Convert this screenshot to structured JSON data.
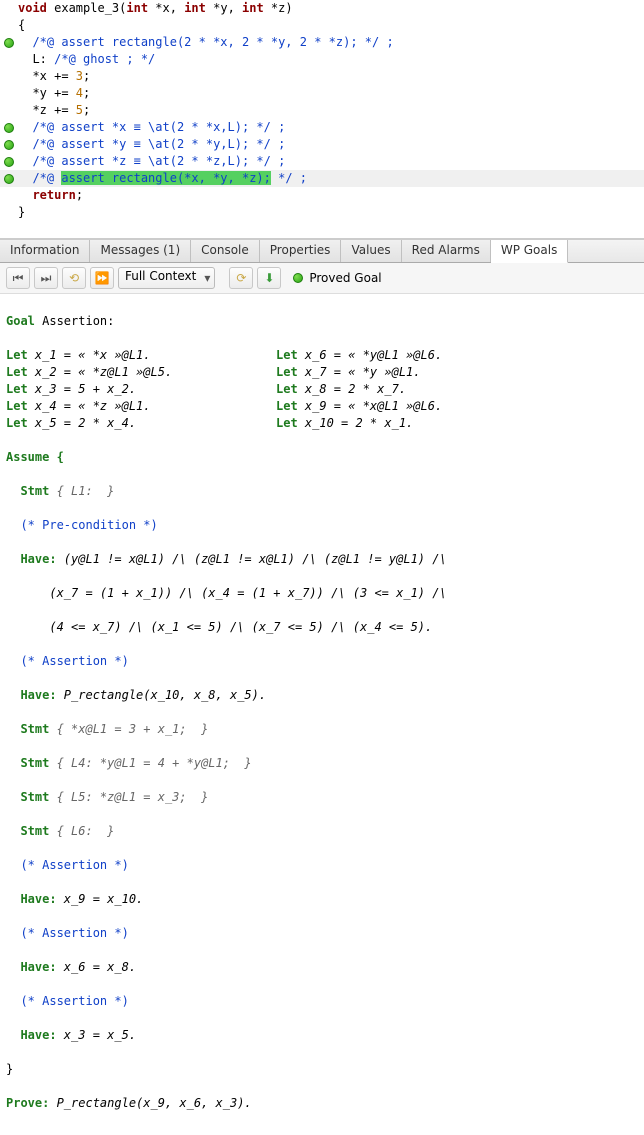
{
  "code": {
    "sig_void": "void",
    "sig_fn": " example_3(",
    "sig_int": "int",
    "sig_p1": " *x, ",
    "sig_p2": " *y, ",
    "sig_p3": " *z)",
    "brace_open": "{",
    "l1": "  /*@ assert rectangle(2 * *x, 2 * *y, 2 * *z); */ ;",
    "l2_a": "  L: ",
    "l2_b": "/*@ ghost ; */",
    "l3_a": "  *x += ",
    "l3_n": "3",
    "l3_b": ";",
    "l4_a": "  *y += ",
    "l4_n": "4",
    "l4_b": ";",
    "l5_a": "  *z += ",
    "l5_n": "5",
    "l5_b": ";",
    "l6": "  /*@ assert *x ≡ \\at(2 * *x,L); */ ;",
    "l7": "  /*@ assert *y ≡ \\at(2 * *y,L); */ ;",
    "l8": "  /*@ assert *z ≡ \\at(2 * *z,L); */ ;",
    "l9_pre": "  /*@ ",
    "l9_sel": "assert rectangle(*x, *y, *z);",
    "l9_post": " */ ;",
    "l10_a": "  ",
    "l10_kw": "return",
    "l10_b": ";",
    "brace_close": "}"
  },
  "tabs": {
    "t0": "Information",
    "t1": "Messages (1)",
    "t2": "Console",
    "t3": "Properties",
    "t4": "Values",
    "t5": "Red Alarms",
    "t6": "WP Goals"
  },
  "toolbar": {
    "context": "Full Context",
    "proved": "Proved Goal"
  },
  "goal": {
    "title_a": "Goal",
    "title_b": " Assertion:",
    "lets": [
      [
        "Let",
        " x_1 = « *x »@L1.",
        "Let",
        " x_6 = « *y@L1 »@L6."
      ],
      [
        "Let",
        " x_2 = « *z@L1 »@L5.",
        "Let",
        " x_7 = « *y »@L1."
      ],
      [
        "Let",
        " x_3 = 5 + x_2.",
        "Let",
        " x_8 = 2 * x_7."
      ],
      [
        "Let",
        " x_4 = « *z »@L1.",
        "Let",
        " x_9 = « *x@L1 »@L6."
      ],
      [
        "Let",
        " x_5 = 2 * x_4.",
        "Let",
        " x_10 = 2 * x_1."
      ]
    ],
    "assume": "Assume {",
    "stmt1_a": "Stmt",
    "stmt1_b": " { L1:  }",
    "c_pre": "(* Pre-condition *)",
    "have1_a": "Have:",
    "have1_b": " (y@L1 != x@L1) /\\ (z@L1 != x@L1) /\\ (z@L1 != y@L1) /\\",
    "have1_c": "      (x_7 = (1 + x_1)) /\\ (x_4 = (1 + x_7)) /\\ (3 <= x_1) /\\",
    "have1_d": "      (4 <= x_7) /\\ (x_1 <= 5) /\\ (x_7 <= 5) /\\ (x_4 <= 5).",
    "c_a1": "(* Assertion *)",
    "have2_a": "Have:",
    "have2_b": " P_rectangle(x_10, x_8, x_5).",
    "stmt2_a": "Stmt",
    "stmt2_b": " { *x@L1 = 3 + x_1;  }",
    "stmt3_a": "Stmt",
    "stmt3_b": " { L4: *y@L1 = 4 + *y@L1;  }",
    "stmt4_a": "Stmt",
    "stmt4_b": " { L5: *z@L1 = x_3;  }",
    "stmt5_a": "Stmt",
    "stmt5_b": " { L6:  }",
    "have3_a": "Have:",
    "have3_b": " x_9 = x_10.",
    "have4_a": "Have:",
    "have4_b": " x_6 = x_8.",
    "have5_a": "Have:",
    "have5_b": " x_3 = x_5.",
    "close": "}",
    "prove_a": "Prove:",
    "prove_b": " P_rectangle(x_9, x_6, x_3)."
  }
}
